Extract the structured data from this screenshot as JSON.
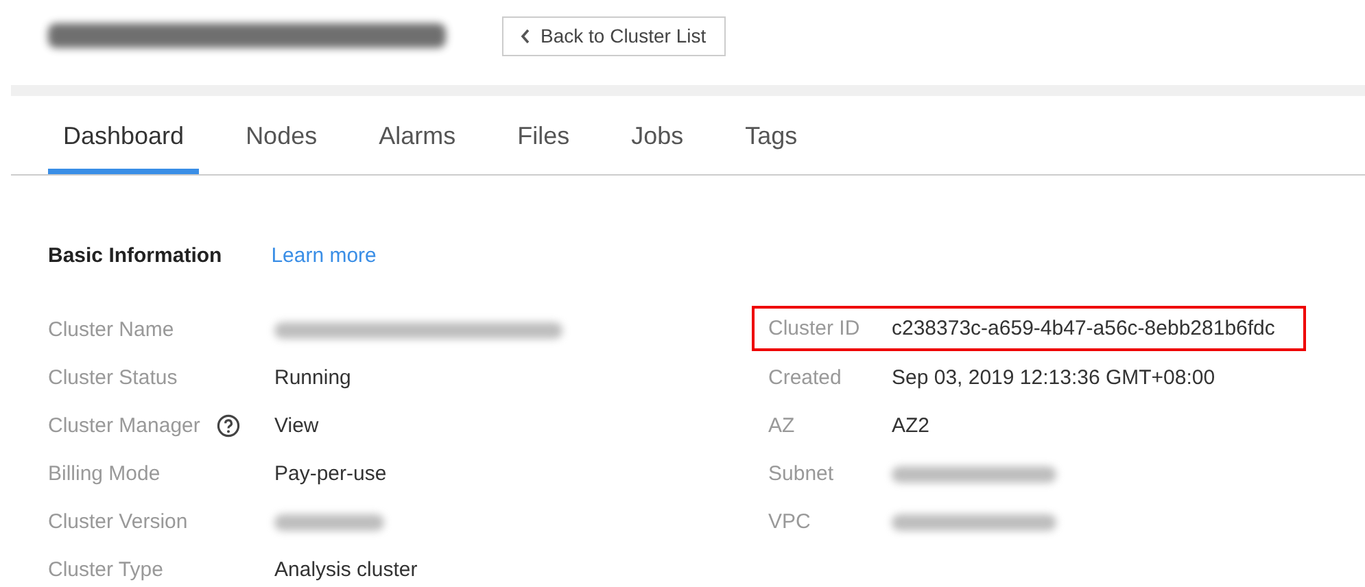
{
  "header": {
    "title": {
      "kind": "redacted"
    },
    "back_button": {
      "label": "Back to Cluster List"
    }
  },
  "tabs": [
    {
      "label": "Dashboard",
      "selected": true
    },
    {
      "label": "Nodes",
      "selected": false
    },
    {
      "label": "Alarms",
      "selected": false
    },
    {
      "label": "Files",
      "selected": false
    },
    {
      "label": "Jobs",
      "selected": false
    },
    {
      "label": "Tags",
      "selected": false
    }
  ],
  "section": {
    "title": "Basic Information",
    "link": "Learn more"
  },
  "left_fields": [
    {
      "label": "Cluster Name",
      "help": false,
      "kind": "redacted",
      "highlighted": false
    },
    {
      "label": "Cluster Status",
      "help": false,
      "kind": "text",
      "value": "Running",
      "highlighted": false
    },
    {
      "label": "Cluster Manager",
      "help": true,
      "kind": "link",
      "value": "View",
      "highlighted": false
    },
    {
      "label": "Billing Mode",
      "help": false,
      "kind": "text",
      "value": "Pay-per-use",
      "highlighted": false
    },
    {
      "label": "Cluster Version",
      "help": false,
      "kind": "redacted",
      "highlighted": false
    },
    {
      "label": "Cluster Type",
      "help": false,
      "kind": "text",
      "value": "Analysis cluster",
      "highlighted": false
    }
  ],
  "right_fields": [
    {
      "label": "Cluster ID",
      "help": false,
      "kind": "text",
      "value": "c238373c-a659-4b47-a56c-8ebb281b6fdc",
      "highlighted": true
    },
    {
      "label": "Created",
      "help": false,
      "kind": "text",
      "value": "Sep 03, 2019 12:13:36 GMT+08:00",
      "highlighted": false
    },
    {
      "label": "AZ",
      "help": false,
      "kind": "text",
      "value": "AZ2",
      "highlighted": false
    },
    {
      "label": "Subnet",
      "help": false,
      "kind": "redacted",
      "highlighted": false
    },
    {
      "label": "VPC",
      "help": false,
      "kind": "redacted",
      "highlighted": false
    }
  ]
}
